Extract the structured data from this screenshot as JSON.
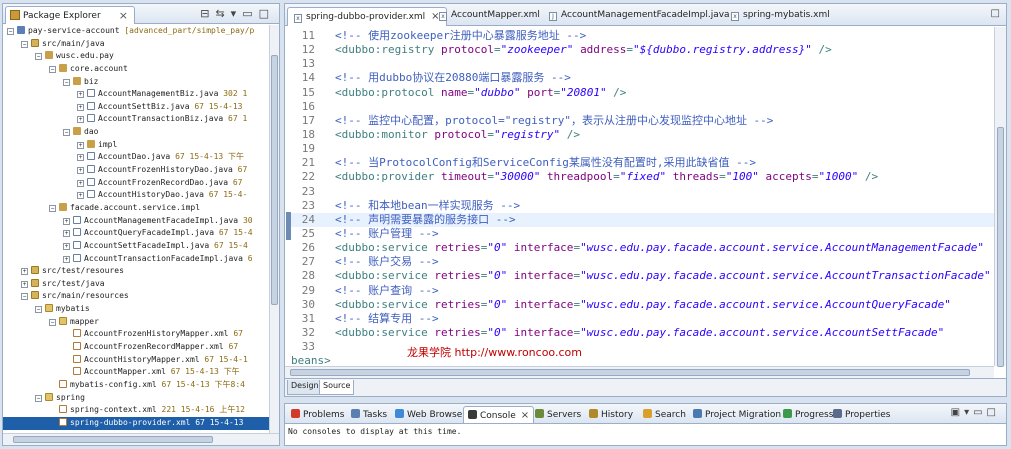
{
  "package_explorer": {
    "title": "Package Explorer",
    "tree": [
      {
        "indent": 0,
        "twisty": "−",
        "icon": "proj",
        "label": "pay-service-account",
        "deco": " [advanced_part/simple_pay/p"
      },
      {
        "indent": 1,
        "twisty": "−",
        "icon": "src",
        "label": "src/main/java",
        "deco": ""
      },
      {
        "indent": 2,
        "twisty": "−",
        "icon": "pkg",
        "label": "wusc.edu.pay",
        "deco": ""
      },
      {
        "indent": 3,
        "twisty": "−",
        "icon": "pkg",
        "label": "core.account",
        "deco": ""
      },
      {
        "indent": 4,
        "twisty": "−",
        "icon": "pkg",
        "label": "biz",
        "deco": ""
      },
      {
        "indent": 5,
        "twisty": "+",
        "icon": "java",
        "label": "AccountManagementBiz.java",
        "deco": " 302  1"
      },
      {
        "indent": 5,
        "twisty": "+",
        "icon": "java",
        "label": "AccountSettBiz.java",
        "deco": " 67  15-4-13"
      },
      {
        "indent": 5,
        "twisty": "+",
        "icon": "java",
        "label": "AccountTransactionBiz.java",
        "deco": " 67  1"
      },
      {
        "indent": 4,
        "twisty": "−",
        "icon": "pkg",
        "label": "dao",
        "deco": ""
      },
      {
        "indent": 5,
        "twisty": "+",
        "icon": "pkg",
        "label": "impl",
        "deco": ""
      },
      {
        "indent": 5,
        "twisty": "+",
        "icon": "java",
        "label": "AccountDao.java",
        "deco": " 67  15-4-13 下午"
      },
      {
        "indent": 5,
        "twisty": "+",
        "icon": "java",
        "label": "AccountFrozenHistoryDao.java",
        "deco": " 67"
      },
      {
        "indent": 5,
        "twisty": "+",
        "icon": "java",
        "label": "AccountFrozenRecordDao.java",
        "deco": " 67"
      },
      {
        "indent": 5,
        "twisty": "+",
        "icon": "java",
        "label": "AccountHistoryDao.java",
        "deco": " 67  15-4-"
      },
      {
        "indent": 3,
        "twisty": "−",
        "icon": "pkg",
        "label": "facade.account.service.impl",
        "deco": ""
      },
      {
        "indent": 4,
        "twisty": "+",
        "icon": "java",
        "label": "AccountManagementFacadeImpl.java",
        "deco": " 30"
      },
      {
        "indent": 4,
        "twisty": "+",
        "icon": "java",
        "label": "AccountQueryFacadeImpl.java",
        "deco": " 67  15-4"
      },
      {
        "indent": 4,
        "twisty": "+",
        "icon": "java",
        "label": "AccountSettFacadeImpl.java",
        "deco": " 67  15-4"
      },
      {
        "indent": 4,
        "twisty": "+",
        "icon": "java",
        "label": "AccountTransactionFacadeImpl.java",
        "deco": " 6"
      },
      {
        "indent": 1,
        "twisty": "+",
        "icon": "src",
        "label": "src/test/resoures",
        "deco": ""
      },
      {
        "indent": 1,
        "twisty": "+",
        "icon": "src",
        "label": "src/test/java",
        "deco": ""
      },
      {
        "indent": 1,
        "twisty": "−",
        "icon": "src",
        "label": "src/main/resources",
        "deco": ""
      },
      {
        "indent": 2,
        "twisty": "−",
        "icon": "folder",
        "label": "mybatis",
        "deco": ""
      },
      {
        "indent": 3,
        "twisty": "−",
        "icon": "folder",
        "label": "mapper",
        "deco": ""
      },
      {
        "indent": 4,
        "twisty": "",
        "icon": "xml",
        "label": "AccountFrozenHistoryMapper.xml",
        "deco": " 67"
      },
      {
        "indent": 4,
        "twisty": "",
        "icon": "xml",
        "label": "AccountFrozenRecordMapper.xml",
        "deco": " 67"
      },
      {
        "indent": 4,
        "twisty": "",
        "icon": "xml",
        "label": "AccountHistoryMapper.xml",
        "deco": " 67  15-4-1"
      },
      {
        "indent": 4,
        "twisty": "",
        "icon": "xml",
        "label": "AccountMapper.xml",
        "deco": " 67  15-4-13 下午"
      },
      {
        "indent": 3,
        "twisty": "",
        "icon": "xml",
        "label": "mybatis-config.xml",
        "deco": " 67  15-4-13 下午8:4"
      },
      {
        "indent": 2,
        "twisty": "−",
        "icon": "folder",
        "label": "spring",
        "deco": ""
      },
      {
        "indent": 3,
        "twisty": "",
        "icon": "xml",
        "label": "spring-context.xml",
        "deco": " 221  15-4-16 上午12"
      },
      {
        "indent": 3,
        "twisty": "",
        "icon": "xml",
        "label": "spring-dubbo-provider.xml",
        "deco": " 67  15-4-13",
        "selected": true
      }
    ]
  },
  "editor": {
    "tabs": [
      {
        "label": "spring-dubbo-provider.xml",
        "icon": "x",
        "active": true
      },
      {
        "label": "AccountMapper.xml",
        "icon": "x",
        "active": false
      },
      {
        "label": "AccountManagementFacadeImpl.java",
        "icon": "J",
        "active": false
      },
      {
        "label": "spring-mybatis.xml",
        "icon": "x",
        "active": false
      }
    ],
    "watermark": "龙果学院 http://www.roncoo.com",
    "bottom_tabs": [
      "Design",
      "Source"
    ],
    "active_bottom_tab": "Source",
    "lines": [
      {
        "n": "11",
        "segs": [
          [
            "c",
            "<!-- 使用zookeeper注册中心暴露服务地址 -->"
          ]
        ]
      },
      {
        "n": "12",
        "segs": [
          [
            "t",
            "<dubbo:registry "
          ],
          [
            "a",
            "protocol"
          ],
          [
            "t",
            "="
          ],
          [
            "s",
            "\"zookeeper\""
          ],
          [
            "t",
            " "
          ],
          [
            "a",
            "address"
          ],
          [
            "t",
            "="
          ],
          [
            "s",
            "\"${dubbo.registry.address}\""
          ],
          [
            "t",
            " />"
          ]
        ]
      },
      {
        "n": "13",
        "segs": []
      },
      {
        "n": "14",
        "segs": [
          [
            "c",
            "<!-- 用dubbo协议在20880端口暴露服务 -->"
          ]
        ]
      },
      {
        "n": "15",
        "segs": [
          [
            "t",
            "<dubbo:protocol "
          ],
          [
            "a",
            "name"
          ],
          [
            "t",
            "="
          ],
          [
            "s",
            "\"dubbo\""
          ],
          [
            "t",
            " "
          ],
          [
            "a",
            "port"
          ],
          [
            "t",
            "="
          ],
          [
            "s",
            "\"20801\""
          ],
          [
            "t",
            " />"
          ]
        ]
      },
      {
        "n": "16",
        "segs": []
      },
      {
        "n": "17",
        "segs": [
          [
            "c",
            "<!-- 监控中心配置，protocol=\"registry\"，表示从注册中心发现监控中心地址 -->"
          ]
        ]
      },
      {
        "n": "18",
        "segs": [
          [
            "t",
            "<dubbo:monitor "
          ],
          [
            "a",
            "protocol"
          ],
          [
            "t",
            "="
          ],
          [
            "s",
            "\"registry\""
          ],
          [
            "t",
            " />"
          ]
        ]
      },
      {
        "n": "19",
        "segs": []
      },
      {
        "n": "21",
        "segs": [
          [
            "c",
            "<!-- 当ProtocolConfig和ServiceConfig某属性没有配置时,采用此缺省值 -->"
          ]
        ]
      },
      {
        "n": "22",
        "segs": [
          [
            "t",
            "<dubbo:provider "
          ],
          [
            "a",
            "timeout"
          ],
          [
            "t",
            "="
          ],
          [
            "s",
            "\"30000\""
          ],
          [
            "t",
            " "
          ],
          [
            "a",
            "threadpool"
          ],
          [
            "t",
            "="
          ],
          [
            "s",
            "\"fixed\""
          ],
          [
            "t",
            " "
          ],
          [
            "a",
            "threads"
          ],
          [
            "t",
            "="
          ],
          [
            "s",
            "\"100\""
          ],
          [
            "t",
            " "
          ],
          [
            "a",
            "accepts"
          ],
          [
            "t",
            "="
          ],
          [
            "s",
            "\"1000\""
          ],
          [
            "t",
            " />"
          ]
        ]
      },
      {
        "n": "23",
        "segs": []
      },
      {
        "n": "23",
        "segs": [
          [
            "c",
            "<!-- 和本地bean一样实现服务 -->"
          ]
        ]
      },
      {
        "n": "24",
        "segs": [
          [
            "c",
            "<!-- 声明需要暴露的服务接口 -->"
          ]
        ],
        "current": true
      },
      {
        "n": "25",
        "segs": [
          [
            "c",
            "<!-- 账户管理 -->"
          ]
        ]
      },
      {
        "n": "26",
        "segs": [
          [
            "t",
            "<dubbo:service "
          ],
          [
            "a",
            "retries"
          ],
          [
            "t",
            "="
          ],
          [
            "s",
            "\"0\""
          ],
          [
            "t",
            " "
          ],
          [
            "a",
            "interface"
          ],
          [
            "t",
            "="
          ],
          [
            "s",
            "\"wusc.edu.pay.facade.account.service.AccountManagementFacade\""
          ]
        ]
      },
      {
        "n": "27",
        "segs": [
          [
            "c",
            "<!-- 账户交易 -->"
          ]
        ]
      },
      {
        "n": "28",
        "segs": [
          [
            "t",
            "<dubbo:service "
          ],
          [
            "a",
            "retries"
          ],
          [
            "t",
            "="
          ],
          [
            "s",
            "\"0\""
          ],
          [
            "t",
            " "
          ],
          [
            "a",
            "interface"
          ],
          [
            "t",
            "="
          ],
          [
            "s",
            "\"wusc.edu.pay.facade.account.service.AccountTransactionFacade\""
          ]
        ]
      },
      {
        "n": "29",
        "segs": [
          [
            "c",
            "<!-- 账户查询 -->"
          ]
        ]
      },
      {
        "n": "30",
        "segs": [
          [
            "t",
            "<dubbo:service "
          ],
          [
            "a",
            "retries"
          ],
          [
            "t",
            "="
          ],
          [
            "s",
            "\"0\""
          ],
          [
            "t",
            " "
          ],
          [
            "a",
            "interface"
          ],
          [
            "t",
            "="
          ],
          [
            "s",
            "\"wusc.edu.pay.facade.account.service.AccountQueryFacade\""
          ]
        ]
      },
      {
        "n": "31",
        "segs": [
          [
            "c",
            "<!-- 结算专用 -->"
          ]
        ]
      },
      {
        "n": "32",
        "segs": [
          [
            "t",
            "<dubbo:service "
          ],
          [
            "a",
            "retries"
          ],
          [
            "t",
            "="
          ],
          [
            "s",
            "\"0\""
          ],
          [
            "t",
            " "
          ],
          [
            "a",
            "interface"
          ],
          [
            "t",
            "="
          ],
          [
            "s",
            "\"wusc.edu.pay.facade.account.service.AccountSettFacade\""
          ]
        ]
      },
      {
        "n": "33",
        "segs": []
      },
      {
        "n": "34",
        "segs": [
          [
            "t",
            "beans>"
          ]
        ],
        "no_indent": true
      }
    ]
  },
  "console_view": {
    "tabs": [
      {
        "label": "Problems",
        "color": "#d23a2a"
      },
      {
        "label": "Tasks",
        "color": "#5a7fb0"
      },
      {
        "label": "Web Browser",
        "color": "#3c8ad8"
      },
      {
        "label": "Console",
        "color": "#3a3a3a",
        "active": true
      },
      {
        "label": "Servers",
        "color": "#6a8c3a"
      },
      {
        "label": "History",
        "color": "#b08a2a"
      },
      {
        "label": "Search",
        "color": "#d8a02a"
      },
      {
        "label": "Project Migration",
        "color": "#4a7ab0"
      },
      {
        "label": "Progress",
        "color": "#3a9a4a"
      },
      {
        "label": "Properties",
        "color": "#5a6a8a"
      }
    ],
    "message": "No consoles to display at this time."
  },
  "colors": {
    "comment": "#3f5fbf",
    "tag": "#3f7f7f",
    "attribute": "#7f007f",
    "string": "#2a00ff",
    "selection": "#1f5ea8",
    "watermark": "#c00000"
  }
}
